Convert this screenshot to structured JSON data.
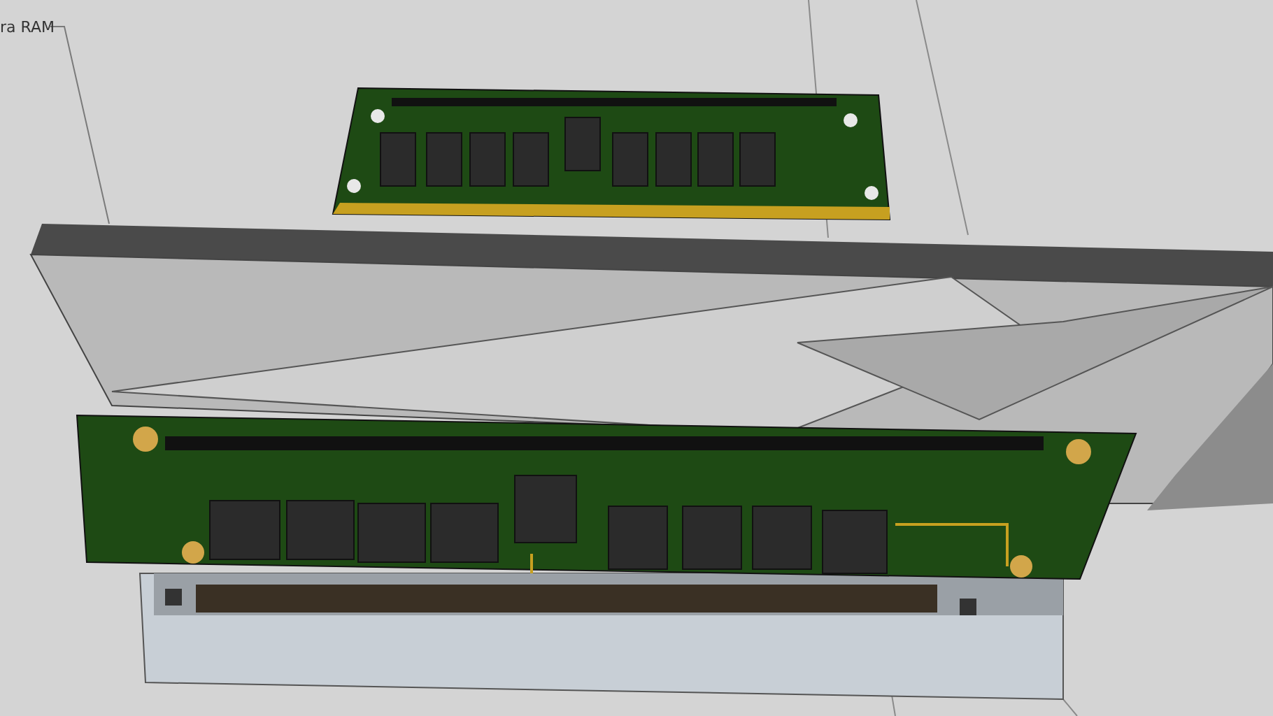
{
  "viewport": {
    "label": "ra RAM"
  }
}
